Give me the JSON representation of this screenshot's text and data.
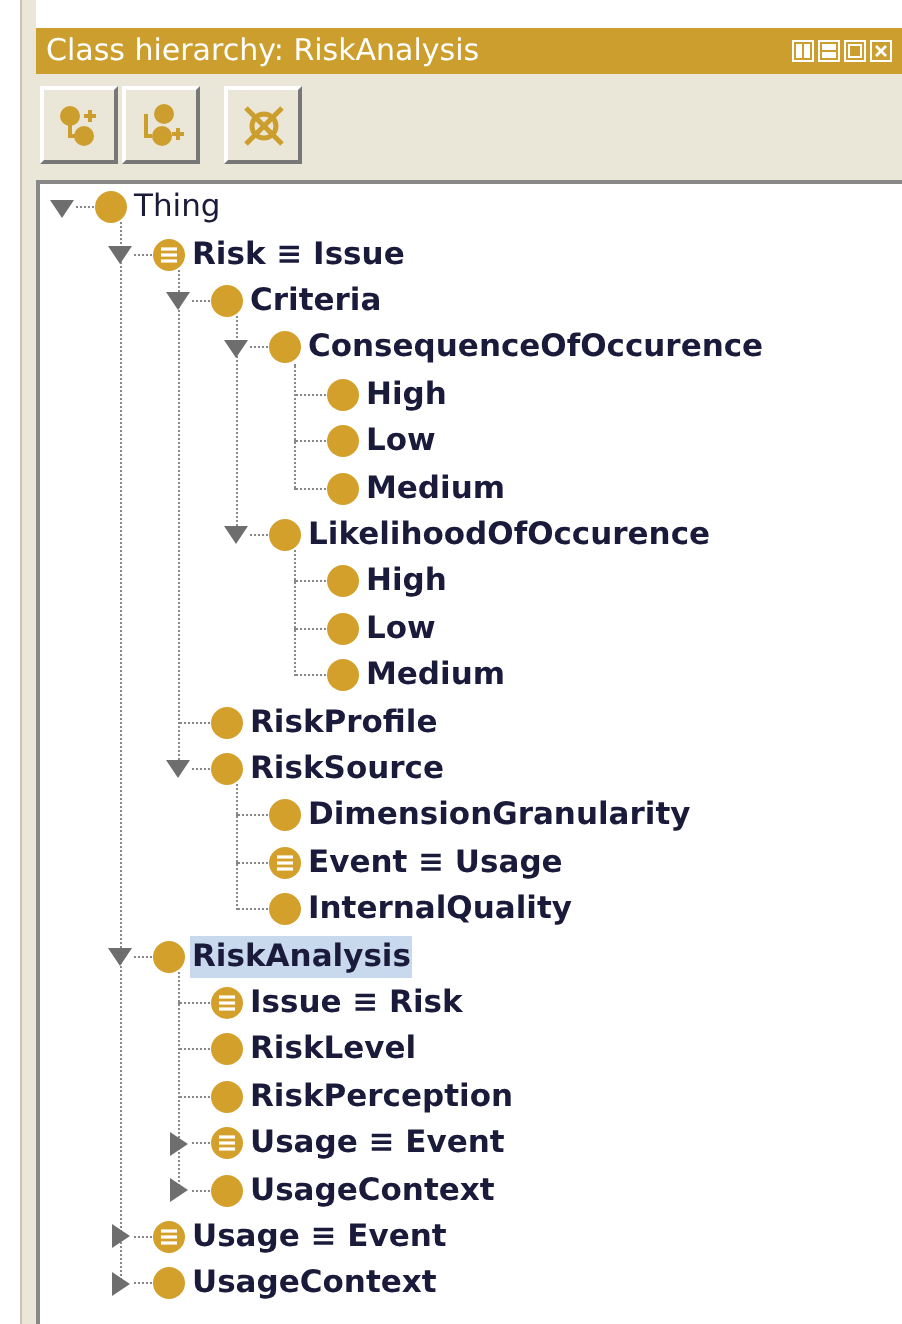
{
  "panel": {
    "title": "Class hierarchy: RiskAnalysis"
  },
  "tree": [
    {
      "label": "Thing",
      "kind": "class",
      "bold": false,
      "selected": false,
      "expanded": true,
      "children": [
        {
          "label": "Risk ≡ Issue",
          "kind": "defined",
          "bold": true,
          "selected": false,
          "expanded": true,
          "children": [
            {
              "label": "Criteria",
              "kind": "class",
              "bold": true,
              "selected": false,
              "expanded": true,
              "children": [
                {
                  "label": "ConsequenceOfOccurence",
                  "kind": "class",
                  "bold": true,
                  "selected": false,
                  "expanded": true,
                  "children": [
                    {
                      "label": "High",
                      "kind": "class",
                      "bold": true,
                      "selected": false
                    },
                    {
                      "label": "Low",
                      "kind": "class",
                      "bold": true,
                      "selected": false
                    },
                    {
                      "label": "Medium",
                      "kind": "class",
                      "bold": true,
                      "selected": false
                    }
                  ]
                },
                {
                  "label": "LikelihoodOfOccurence",
                  "kind": "class",
                  "bold": true,
                  "selected": false,
                  "expanded": true,
                  "children": [
                    {
                      "label": "High",
                      "kind": "class",
                      "bold": true,
                      "selected": false
                    },
                    {
                      "label": "Low",
                      "kind": "class",
                      "bold": true,
                      "selected": false
                    },
                    {
                      "label": "Medium",
                      "kind": "class",
                      "bold": true,
                      "selected": false
                    }
                  ]
                }
              ]
            },
            {
              "label": "RiskProfile",
              "kind": "class",
              "bold": true,
              "selected": false
            },
            {
              "label": "RiskSource",
              "kind": "class",
              "bold": true,
              "selected": false,
              "expanded": true,
              "children": [
                {
                  "label": "DimensionGranularity",
                  "kind": "class",
                  "bold": true,
                  "selected": false
                },
                {
                  "label": "Event ≡ Usage",
                  "kind": "defined",
                  "bold": true,
                  "selected": false
                },
                {
                  "label": "InternalQuality",
                  "kind": "class",
                  "bold": true,
                  "selected": false
                }
              ]
            }
          ]
        },
        {
          "label": "RiskAnalysis",
          "kind": "class",
          "bold": true,
          "selected": true,
          "expanded": true,
          "children": [
            {
              "label": "Issue ≡ Risk",
              "kind": "defined",
              "bold": true,
              "selected": false
            },
            {
              "label": "RiskLevel",
              "kind": "class",
              "bold": true,
              "selected": false
            },
            {
              "label": "RiskPerception",
              "kind": "class",
              "bold": true,
              "selected": false
            },
            {
              "label": "Usage ≡ Event",
              "kind": "defined",
              "bold": true,
              "selected": false,
              "expanded": false
            },
            {
              "label": "UsageContext",
              "kind": "class",
              "bold": true,
              "selected": false,
              "expanded": false
            }
          ]
        },
        {
          "label": "Usage ≡ Event",
          "kind": "defined",
          "bold": true,
          "selected": false,
          "expanded": false
        },
        {
          "label": "UsageContext",
          "kind": "class",
          "bold": true,
          "selected": false,
          "expanded": false
        }
      ]
    }
  ]
}
